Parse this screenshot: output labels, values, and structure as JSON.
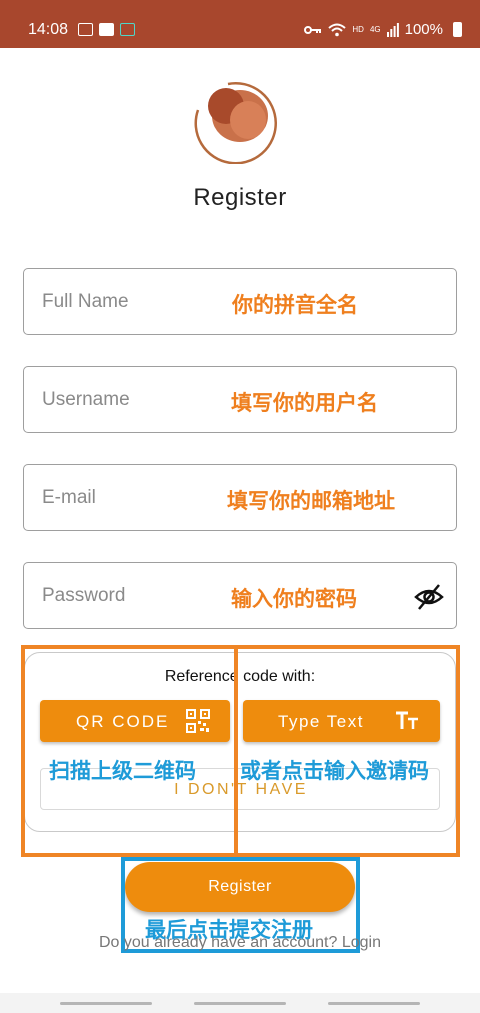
{
  "status_bar": {
    "time": "14:08",
    "hd": "HD",
    "net": "4G",
    "battery": "100%"
  },
  "colors": {
    "status_bar": "#a8472d",
    "accent": "#ee8c0d",
    "annotation_orange": "#ef8525",
    "annotation_blue": "#1e9bd8"
  },
  "page": {
    "title": "Register"
  },
  "form": {
    "full_name": {
      "placeholder": "Full Name",
      "hint": "你的拼音全名"
    },
    "username": {
      "placeholder": "Username",
      "hint": "填写你的用户名"
    },
    "email": {
      "placeholder": "E-mail",
      "hint": "填写你的邮箱地址"
    },
    "password": {
      "placeholder": "Password",
      "hint": "输入你的密码",
      "icon": "eye-off-icon"
    }
  },
  "reference": {
    "label": "Reference code with:",
    "qr_button": "QR CODE",
    "qr_icon": "qr-code-icon",
    "type_button": "Type Text",
    "type_icon": "text-size-icon",
    "no_code_button": "I DON'T HAVE",
    "hint_qr": "扫描上级二维码",
    "hint_type": "或者点击输入邀请码"
  },
  "submit": {
    "label": "Register",
    "hint": "最后点击提交注册"
  },
  "footer": {
    "login_text": "Do you already have an account? Login"
  }
}
